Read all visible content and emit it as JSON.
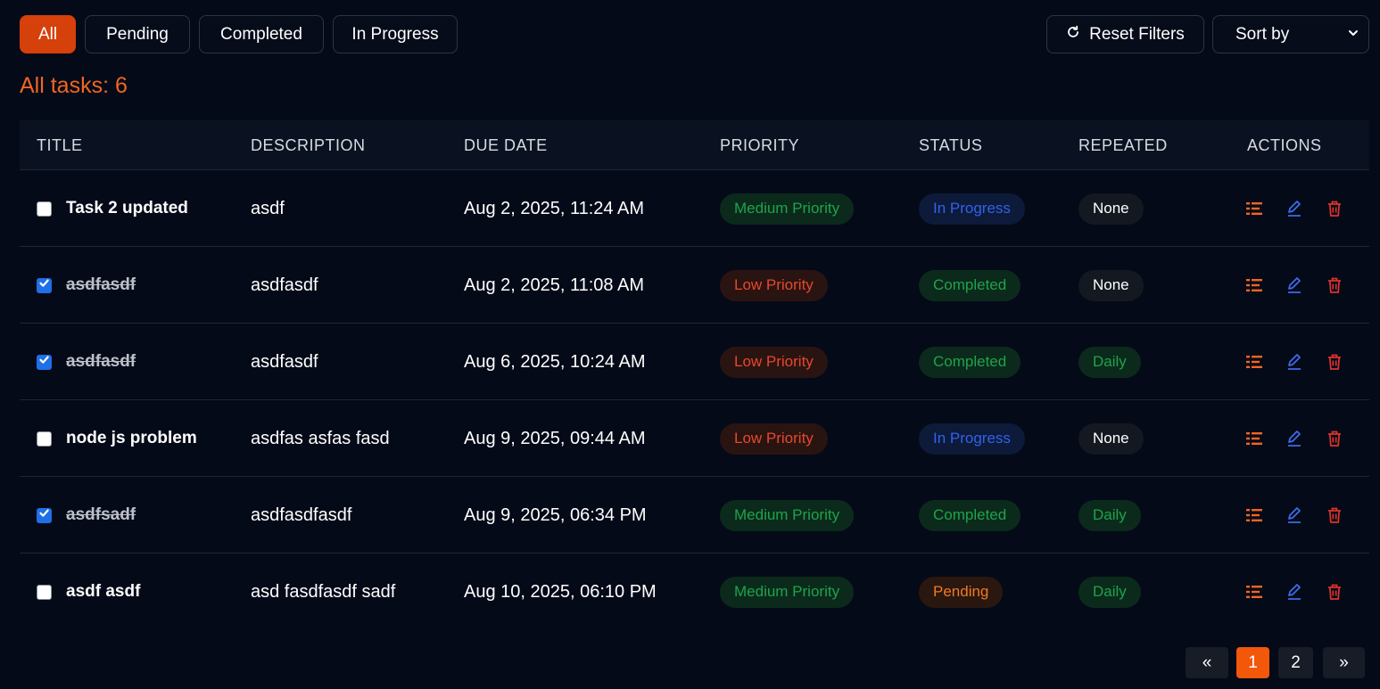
{
  "filters": {
    "tabs": [
      {
        "label": "All",
        "active": true
      },
      {
        "label": "Pending",
        "active": false
      },
      {
        "label": "Completed",
        "active": false
      },
      {
        "label": "In Progress",
        "active": false
      }
    ],
    "reset_label": "Reset Filters",
    "sort_label": "Sort by"
  },
  "summary": {
    "count_label": "All tasks: 6"
  },
  "table": {
    "headers": [
      "TITLE",
      "DESCRIPTION",
      "DUE DATE",
      "PRIORITY",
      "STATUS",
      "REPEATED",
      "ACTIONS"
    ],
    "rows": [
      {
        "checked": false,
        "title": "Task 2 updated",
        "description": "asdf",
        "due": "Aug 2, 2025, 11:24 AM",
        "priority": "Medium Priority",
        "status": "In Progress",
        "repeated": "None"
      },
      {
        "checked": true,
        "title": "asdfasdf",
        "description": "asdfasdf",
        "due": "Aug 2, 2025, 11:08 AM",
        "priority": "Low Priority",
        "status": "Completed",
        "repeated": "None"
      },
      {
        "checked": true,
        "title": "asdfasdf",
        "description": "asdfasdf",
        "due": "Aug 6, 2025, 10:24 AM",
        "priority": "Low Priority",
        "status": "Completed",
        "repeated": "Daily"
      },
      {
        "checked": false,
        "title": "node js problem",
        "description": "asdfas asfas fasd",
        "due": "Aug 9, 2025, 09:44 AM",
        "priority": "Low Priority",
        "status": "In Progress",
        "repeated": "None"
      },
      {
        "checked": true,
        "title": "asdfsadf",
        "description": "asdfasdfasdf",
        "due": "Aug 9, 2025, 06:34 PM",
        "priority": "Medium Priority",
        "status": "Completed",
        "repeated": "Daily"
      },
      {
        "checked": false,
        "title": "asdf asdf",
        "description": "asd fasdfasdf sadf",
        "due": "Aug 10, 2025, 06:10 PM",
        "priority": "Medium Priority",
        "status": "Pending",
        "repeated": "Daily"
      }
    ]
  },
  "pagination": {
    "prev_label": "«",
    "pages": [
      "1",
      "2"
    ],
    "current": "1",
    "next_label": "»"
  },
  "colors": {
    "accent": "#f26522",
    "background": "#050a18",
    "in_progress": "#2f63e8",
    "completed": "#1fa34a",
    "low": "#e8472b",
    "pending": "#f07a22"
  }
}
